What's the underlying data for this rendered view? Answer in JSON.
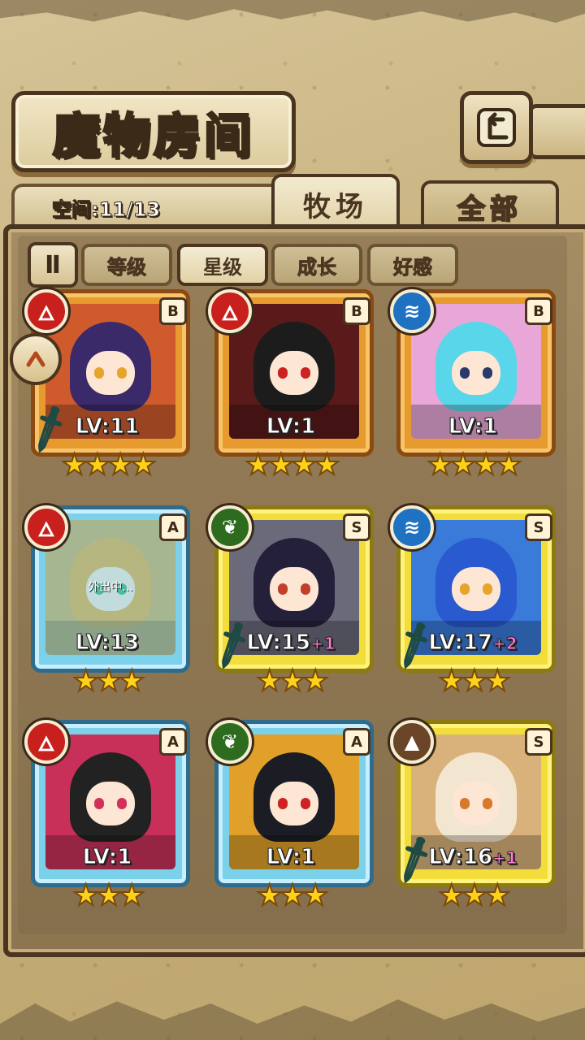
{
  "header": {
    "title": "魔物房间",
    "back_icon": "back-arrow-icon"
  },
  "space": {
    "label": "空间:11/13"
  },
  "tabs": [
    {
      "label": "牧场",
      "active": true
    },
    {
      "label": "全部",
      "active": false
    }
  ],
  "filters": {
    "toggle_symbol": "Ⅱ",
    "items": [
      {
        "label": "等级",
        "active": false
      },
      {
        "label": "星级",
        "active": true
      },
      {
        "label": "成长",
        "active": false
      },
      {
        "label": "好感",
        "active": false
      }
    ]
  },
  "side_button": {
    "icon": "arrow-icon"
  },
  "colors": {
    "fire": "#c8201d",
    "water": "#1f72c2",
    "leaf": "#2d6c1e",
    "earth": "#6a4528",
    "rank_B": "#e79a2e",
    "rank_A": "#7bd0ea",
    "rank_S": "#f2dd3a"
  },
  "cards": [
    {
      "rank": "B",
      "element": "fire",
      "element_icon": "fire-icon",
      "level": "LV:11",
      "bonus": "",
      "stars": "★★★★",
      "sword": true,
      "status": "",
      "hair": "#3a2a6a",
      "eye": "#e6a52a",
      "bg": "#cf5b2d"
    },
    {
      "rank": "B",
      "element": "fire",
      "element_icon": "fire-icon",
      "level": "LV:1",
      "bonus": "",
      "stars": "★★★★",
      "sword": false,
      "status": "",
      "hair": "#1c1c1c",
      "eye": "#c22",
      "bg": "#5a1a1a"
    },
    {
      "rank": "B",
      "element": "water",
      "element_icon": "water-icon",
      "level": "LV:1",
      "bonus": "",
      "stars": "★★★★",
      "sword": false,
      "status": "",
      "hair": "#5ad6ea",
      "eye": "#2a3a6a",
      "bg": "#e8a7d8"
    },
    {
      "rank": "A",
      "element": "fire",
      "element_icon": "fire-icon",
      "level": "LV:13",
      "bonus": "",
      "stars": "★★★",
      "sword": false,
      "status": "外出中...",
      "hair": "#e6a12a",
      "eye": "#2a6",
      "bg": "#caa24a"
    },
    {
      "rank": "S",
      "element": "leaf",
      "element_icon": "leaf-icon",
      "level": "LV:15",
      "bonus": "+1",
      "stars": "★★★",
      "sword": true,
      "status": "",
      "hair": "#24203a",
      "eye": "#c2402a",
      "bg": "#6a6a7a"
    },
    {
      "rank": "S",
      "element": "water",
      "element_icon": "water-icon",
      "level": "LV:17",
      "bonus": "+2",
      "stars": "★★★",
      "sword": true,
      "status": "",
      "hair": "#2a5acf",
      "eye": "#e6a52a",
      "bg": "#3a7ad8"
    },
    {
      "rank": "A",
      "element": "fire",
      "element_icon": "fire-icon",
      "level": "LV:1",
      "bonus": "",
      "stars": "★★★",
      "sword": false,
      "status": "",
      "hair": "#222222",
      "eye": "#d2305a",
      "bg": "#c8305a"
    },
    {
      "rank": "A",
      "element": "leaf",
      "element_icon": "leaf-icon",
      "level": "LV:1",
      "bonus": "",
      "stars": "★★★",
      "sword": false,
      "status": "",
      "hair": "#1c1c24",
      "eye": "#c22",
      "bg": "#e0a02a"
    },
    {
      "rank": "S",
      "element": "earth",
      "element_icon": "earth-icon",
      "level": "LV:16",
      "bonus": "+1",
      "stars": "★★★",
      "sword": true,
      "status": "",
      "hair": "#f2e6d0",
      "eye": "#d8782a",
      "bg": "#d8b27a"
    }
  ]
}
